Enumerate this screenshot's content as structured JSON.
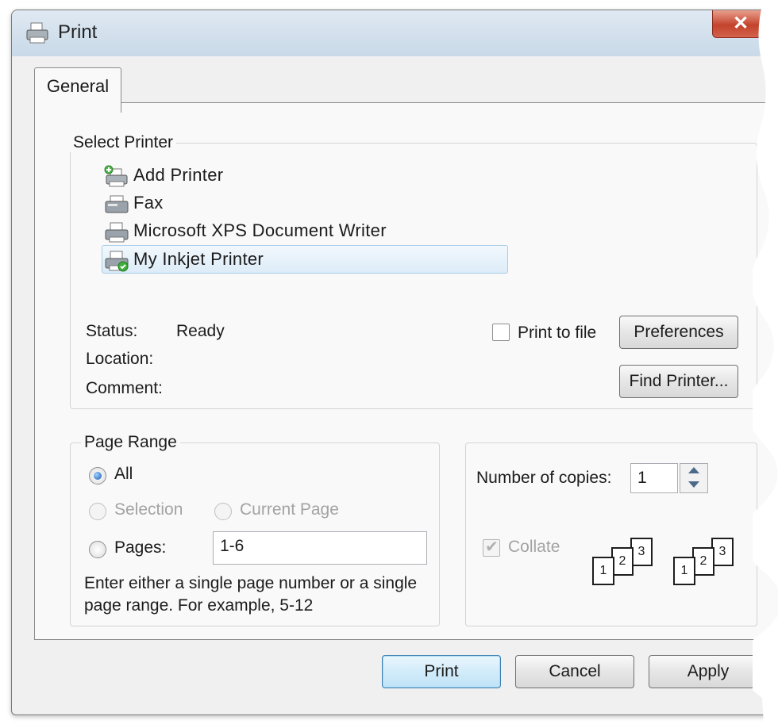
{
  "window": {
    "title": "Print",
    "close_glyph": "✕"
  },
  "tabs": [
    {
      "label": "General"
    }
  ],
  "select_printer": {
    "label": "Select Printer",
    "printers": [
      {
        "name": "Add Printer",
        "icon": "add-printer-icon"
      },
      {
        "name": "Fax",
        "icon": "fax-icon"
      },
      {
        "name": "Microsoft XPS Document Writer",
        "icon": "printer-icon"
      },
      {
        "name": "My Inkjet Printer",
        "icon": "default-printer-icon",
        "selected": true
      }
    ],
    "status_label": "Status:",
    "status_value": "Ready",
    "location_label": "Location:",
    "comment_label": "Comment:",
    "print_to_file_label": "Print to file",
    "print_to_file_checked": false,
    "preferences_label": "Preferences",
    "find_printer_label": "Find Printer..."
  },
  "page_range": {
    "label": "Page Range",
    "all_label": "All",
    "selection_label": "Selection",
    "current_page_label": "Current Page",
    "pages_label": "Pages:",
    "pages_value": "1-6",
    "selected": "All",
    "help_line1": "Enter either a single page number or a single",
    "help_line2": "page range.  For example, 5-12"
  },
  "copies": {
    "label": "Number of copies:",
    "value": "1",
    "collate_label": "Collate",
    "collate_checked": true,
    "collate_enabled": false,
    "page_numbers": [
      "1",
      "2",
      "3"
    ]
  },
  "buttons": {
    "print": "Print",
    "cancel": "Cancel",
    "apply": "Apply"
  },
  "colors": {
    "selection_highlight": "#dcecf8",
    "close_button": "#c3432c",
    "default_button_border": "#3c7fb1"
  }
}
